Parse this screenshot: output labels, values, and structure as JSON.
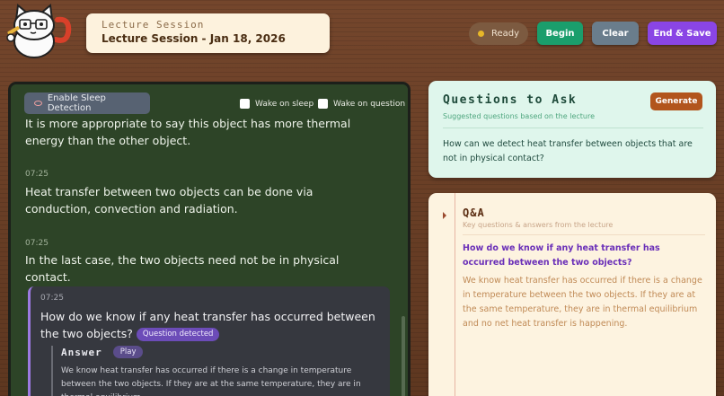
{
  "header": {
    "session_label": "Lecture Session",
    "session_title": "Lecture Session - Jan 18, 2026",
    "status": "Ready",
    "begin_label": "Begin",
    "clear_label": "Clear",
    "end_label": "End & Save"
  },
  "transcript": {
    "sleep_button": "Enable Sleep Detection",
    "wake_on_sleep": "Wake on sleep",
    "wake_on_question": "Wake on question",
    "entries": [
      {
        "time": "",
        "text": "It is more appropriate to say this object has more thermal energy than the other object."
      },
      {
        "time": "07:25",
        "text": "Heat transfer between two objects can be done via conduction, convection and radiation."
      },
      {
        "time": "07:25",
        "text": "In the last case, the two objects need not be in physical contact."
      }
    ],
    "question": {
      "time": "07:25",
      "text": "How do we know if any heat transfer has occurred between the two objects?",
      "badge": "Question detected",
      "answer_label": "Answer",
      "play_label": "Play",
      "answer_text": "We know heat transfer has occurred if there is a change in temperature between the two objects. If they are at the same temperature, they are in thermal equilibrium"
    }
  },
  "questions_panel": {
    "title": "Questions to Ask",
    "subtitle": "Suggested questions based on the lecture",
    "generate_label": "Generate",
    "items": [
      "How can we detect heat transfer between objects that are not in physical contact?"
    ]
  },
  "qa_panel": {
    "title": "Q&A",
    "subtitle": "Key questions & answers from the lecture",
    "items": [
      {
        "q": "How do we know if any heat transfer has occurred between the two objects?",
        "a": "We know heat transfer has occurred if there is a change in temperature between the two objects. If they are at the same temperature, they are in thermal equilibrium and no net heat transfer is happening."
      }
    ]
  },
  "colors": {
    "begin": "#1a9e6c",
    "clear": "#6a7d8c",
    "end": "#8a45e5",
    "generate": "#b2551d",
    "status_dot": "#e7b728"
  },
  "icons": [
    "cat-mascot-icon",
    "eye-icon",
    "status-dot-icon",
    "collapse-arrow-icon"
  ]
}
